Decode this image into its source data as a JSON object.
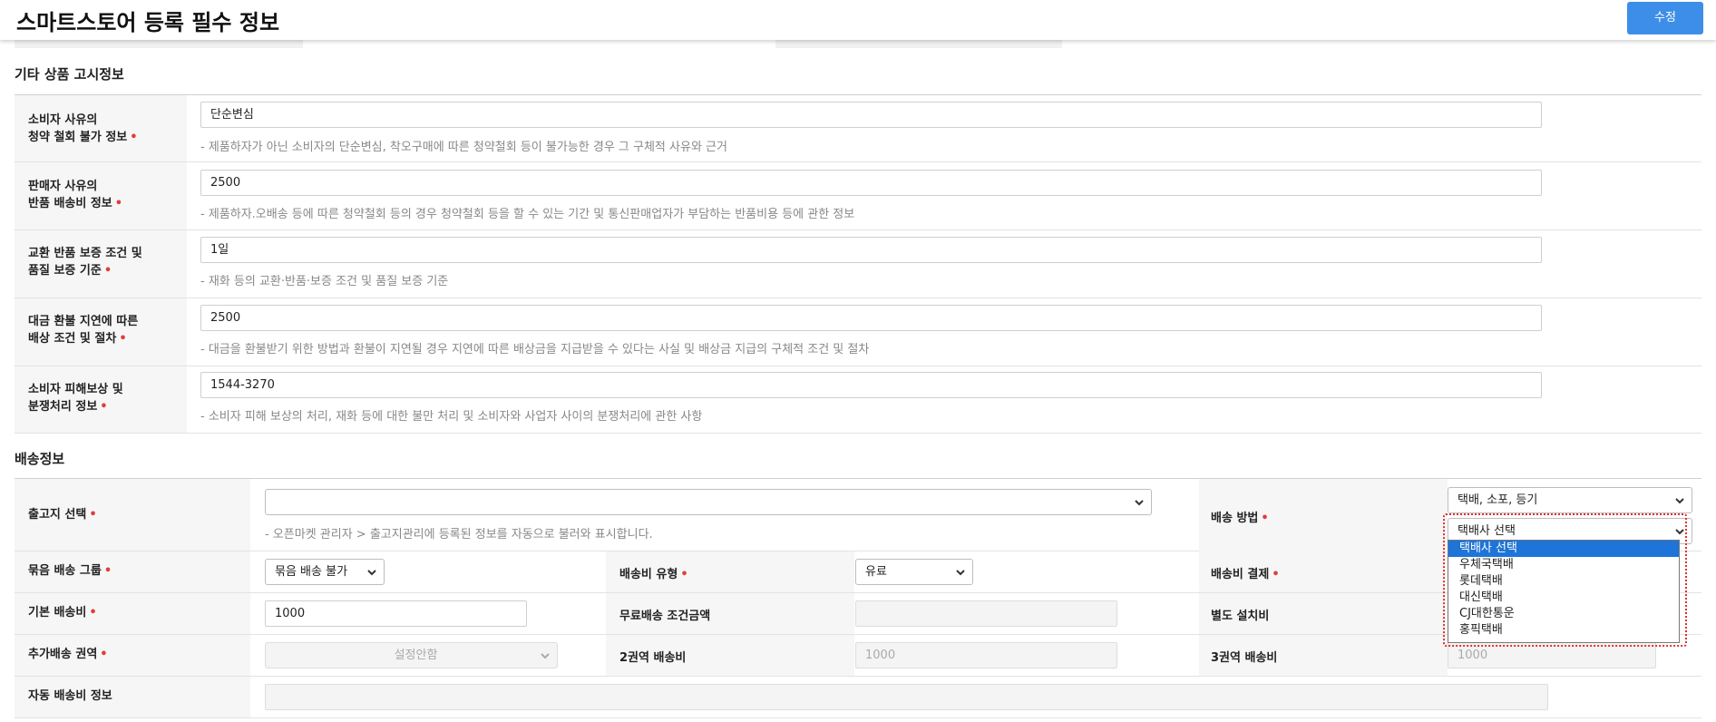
{
  "header": {
    "title": "스마트스토어 등록 필수 정보",
    "edit_button": "수정"
  },
  "notice_section": {
    "title": "기타 상품 고시정보",
    "rows": [
      {
        "label_line1": "소비자 사유의",
        "label_line2": "청약 철회 불가 정보",
        "value": "단순변심",
        "hint": "- 제품하자가 아닌 소비자의 단순변심, 착오구매에 따른 청약철회 등이 불가능한 경우 그 구체적 사유와 근거"
      },
      {
        "label_line1": "판매자 사유의",
        "label_line2": "반품 배송비 정보",
        "value": "2500",
        "hint": "- 제품하자.오배송 등에 따른 청약철회 등의 경우 청약철회 등을 할 수 있는 기간 및 통신판매업자가 부담하는 반품비용 등에 관한 정보"
      },
      {
        "label_line1": "교환 반품 보증 조건 및",
        "label_line2": "품질 보증 기준",
        "value": "1일",
        "hint": "- 재화 등의 교환·반품·보증 조건 및 품질 보증 기준"
      },
      {
        "label_line1": "대금 환불 지연에 따른",
        "label_line2": "배상 조건 및 절차",
        "value": "2500",
        "hint": "- 대금을 환불받기 위한 방법과 환불이 지연될 경우 지연에 따른 배상금을 지급받을 수 있다는 사실 및 배상금 지급의 구체적 조건 및 절차"
      },
      {
        "label_line1": "소비자 피해보상 및",
        "label_line2": "분쟁처리 정보",
        "value": "1544-3270",
        "hint": "- 소비자 피해 보상의 처리, 재화 등에 대한 불만 처리 및 소비자와 사업자 사이의 분쟁처리에 관한 사항"
      }
    ]
  },
  "shipping_section": {
    "title": "배송정보",
    "warehouse_label": "출고지 선택",
    "warehouse_value": "",
    "warehouse_hint": "- 오픈마켓 관리자 > 출고지관리에 등록된 정보를 자동으로 불러와 표시합니다.",
    "method_label": "배송 방법",
    "method_value": "택배, 소포, 등기",
    "courier_value": "택배사 선택",
    "courier_options": [
      "택배사 선택",
      "우체국택배",
      "롯데택배",
      "대신택배",
      "CJ대한통운",
      "홍픽택배"
    ],
    "bundle_label": "묶음 배송 그룹",
    "bundle_value": "묶음 배송 불가",
    "fee_type_label": "배송비 유형",
    "fee_type_value": "유료",
    "fee_payment_label": "배송비 결제",
    "base_fee_label": "기본 배송비",
    "base_fee_value": "1000",
    "free_condition_label": "무료배송 조건금액",
    "free_condition_value": "",
    "install_fee_label": "별도 설치비",
    "extra_zone_label": "추가배송 권역",
    "extra_zone_value": "설정안함",
    "zone2_label": "2권역 배송비",
    "zone2_placeholder": "1000",
    "zone3_label": "3권역 배송비",
    "zone3_placeholder": "1000",
    "auto_fee_label": "자동 배송비 정보",
    "auto_fee_value": ""
  },
  "colors": {
    "accent": "#3d8ee8",
    "required": "#e23b3b",
    "dropdown_selected": "#1e74d8",
    "highlight": "#e03030"
  },
  "icons": {
    "select_arrow": "chevron-down-icon"
  }
}
